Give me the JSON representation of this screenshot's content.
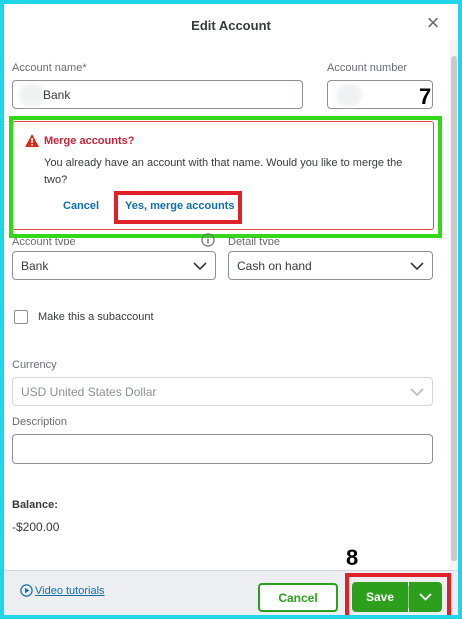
{
  "dialog": {
    "title": "Edit Account",
    "account_name_label": "Account name*",
    "account_name_value": "Bank",
    "account_number_label": "Account number",
    "account_type_label": "Account type",
    "account_type_value": "Bank",
    "detail_type_label": "Detail type",
    "detail_type_value": "Cash on hand",
    "subaccount_label": "Make this a subaccount",
    "currency_label": "Currency",
    "currency_value": "USD United States Dollar",
    "description_label": "Description",
    "description_value": "",
    "balance_label": "Balance:",
    "balance_value": "-$200.00"
  },
  "alert": {
    "title": "Merge accounts?",
    "message": "You already have an account with that name. Would you like to merge the two?",
    "cancel_label": "Cancel",
    "confirm_label": "Yes, merge accounts"
  },
  "footer": {
    "video_tutorials_label": "Video tutorials",
    "cancel_label": "Cancel",
    "save_label": "Save"
  },
  "annotations": {
    "step_merge": "7",
    "step_save": "8"
  },
  "colors": {
    "accent_green": "#2ca01c",
    "alert_red": "#c5243b",
    "annotation_green": "#33d81a",
    "annotation_red": "#e0212a",
    "link_blue": "#0f6ea8"
  },
  "icons": {
    "close": "close-icon",
    "warning": "warning-icon",
    "info": "info-icon",
    "chevron": "chevron-down-icon",
    "play": "play-circle-icon"
  }
}
